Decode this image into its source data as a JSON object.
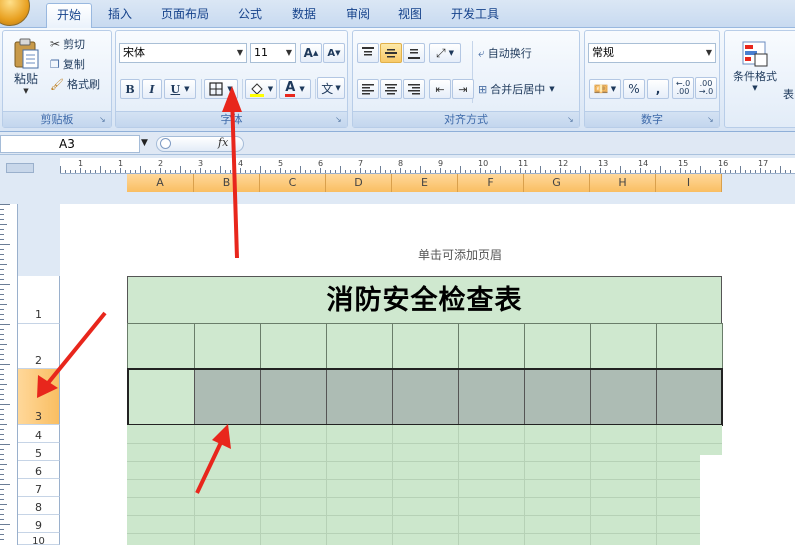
{
  "tabs": [
    "开始",
    "插入",
    "页面布局",
    "公式",
    "数据",
    "审阅",
    "视图",
    "开发工具"
  ],
  "clipboard": {
    "paste": "粘贴",
    "cut": "剪切",
    "copy": "复制",
    "format_painter": "格式刷",
    "group": "剪贴板"
  },
  "font": {
    "name": "宋体",
    "size": "11",
    "bold": "B",
    "italic": "I",
    "underline": "U",
    "font_color_glyph": "A",
    "phonetic_glyph": "文",
    "grow": "A",
    "shrink": "A",
    "group": "字体"
  },
  "alignment": {
    "wrap": "自动换行",
    "merge": "合并后居中",
    "group": "对齐方式"
  },
  "number": {
    "format": "常规",
    "percent": "%",
    "comma": ",",
    "inc_decimal": ".00",
    "dec_decimal": ".00",
    "group": "数字"
  },
  "styles": {
    "conditional": "条件格式",
    "table": "表"
  },
  "formula_bar": {
    "name_box": "A3",
    "fx": "fx"
  },
  "columns": [
    "A",
    "B",
    "C",
    "D",
    "E",
    "F",
    "G",
    "H",
    "I"
  ],
  "ruler_numbers": [
    "1",
    "1",
    "2",
    "3",
    "4",
    "5",
    "6",
    "7",
    "8",
    "9",
    "10",
    "11",
    "12",
    "13",
    "14",
    "15",
    "16",
    "17"
  ],
  "rows": [
    "1",
    "2",
    "3",
    "4",
    "5",
    "6",
    "7",
    "8",
    "9",
    "10"
  ],
  "sheet": {
    "header_hint": "单击可添加页眉",
    "title": "消防安全检查表"
  },
  "colors": {
    "cell_green": "#cfe8cf",
    "selected_gray": "#adbcb4",
    "header_orange": "#f9be62",
    "arrow_red": "#e8261c"
  }
}
